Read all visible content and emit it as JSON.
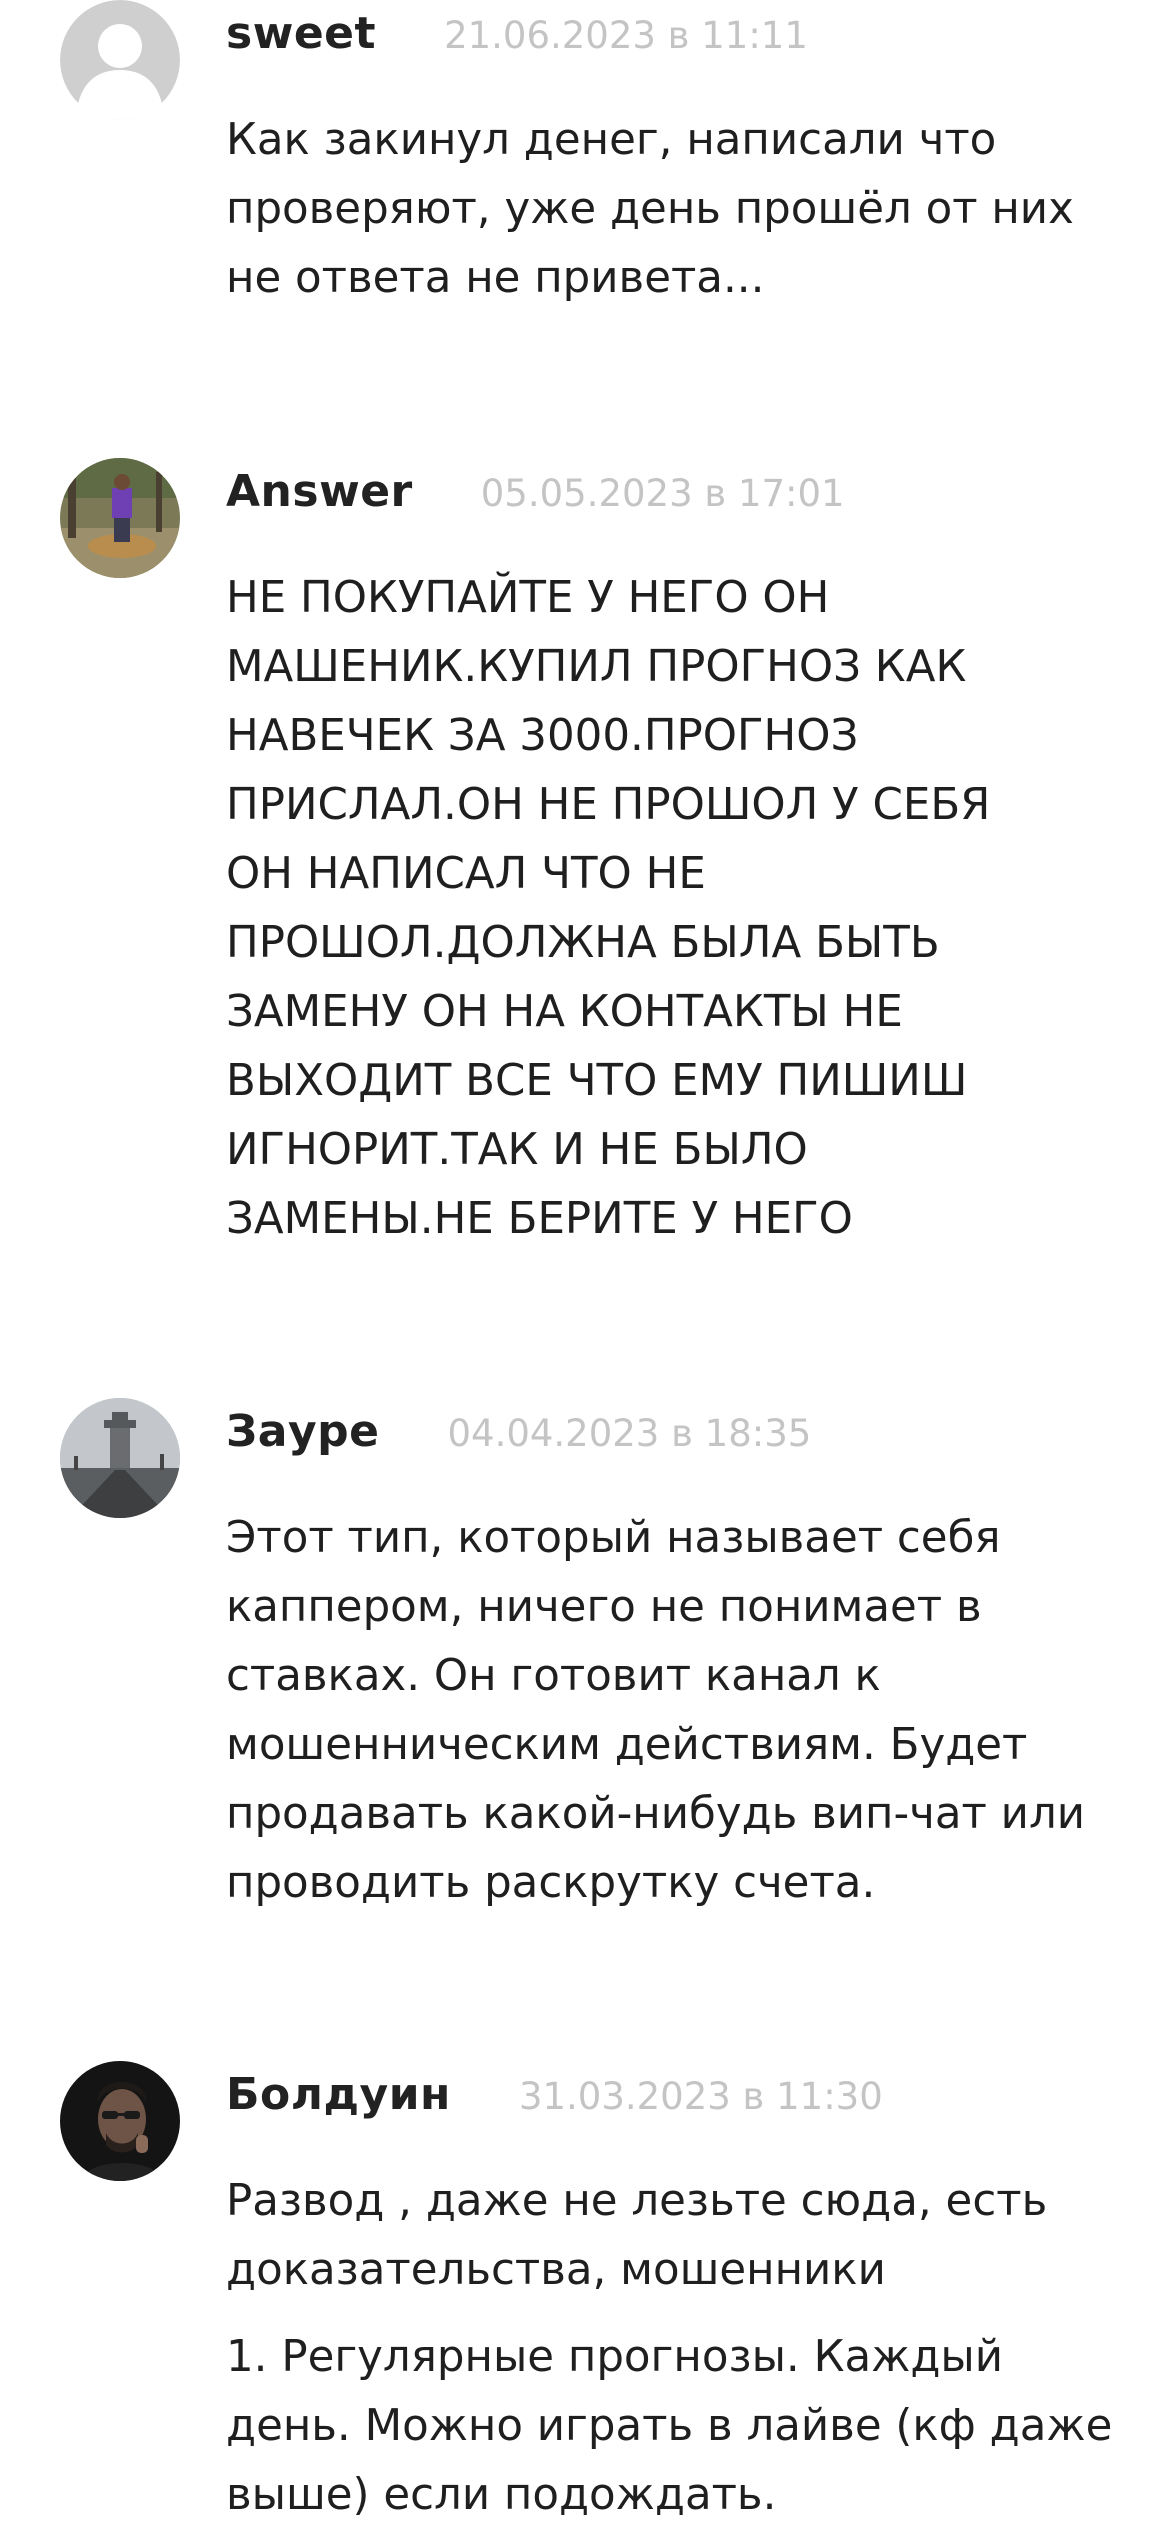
{
  "comments": [
    {
      "author": "sweet",
      "date": "21.06.2023 в 11:11",
      "lines": [
        "Как закинул денег, написали что",
        "проверяют, уже день прошёл от них",
        "не ответа не привета..."
      ]
    },
    {
      "author": "Answer",
      "date": "05.05.2023 в 17:01",
      "lines": [
        "НЕ ПОКУПАЙТЕ У НЕГО ОН",
        "МАШЕНИК.КУПИЛ ПРОГНОЗ КАК",
        "НАВЕЧЕК ЗА 3000.ПРОГНОЗ",
        "ПРИСЛАЛ.ОН НЕ ПРОШОЛ У СЕБЯ",
        "ОН НАПИСАЛ ЧТО НЕ",
        "ПРОШОЛ.ДОЛЖНА БЫЛА БЫТЬ",
        "ЗАМЕНУ ОН НА КОНТАКТЫ НЕ",
        "ВЫХОДИТ ВСЕ ЧТО ЕМУ ПИШИШ",
        "ИГНОРИТ.ТАК И НЕ БЫЛО",
        "ЗАМЕНЫ.НЕ БЕРИТЕ У НЕГО"
      ]
    },
    {
      "author": "Зауре",
      "date": "04.04.2023 в 18:35",
      "lines": [
        "Этот тип, который называет себя",
        "каппером, ничего не понимает в",
        "ставках. Он готовит канал к",
        "мошенническим действиям. Будет",
        "продавать какой-нибудь вип-чат или",
        "проводить раскрутку счета."
      ]
    },
    {
      "author": "Болдуин",
      "date": "31.03.2023 в 11:30",
      "lines": [
        "Развод , даже не лезьте сюда, есть",
        "доказательства, мошенники"
      ],
      "lines2": [
        "1. Регулярные прогнозы. Каждый",
        "день. Можно играть в лайве (кф даже",
        "выше) если подождать."
      ]
    }
  ]
}
